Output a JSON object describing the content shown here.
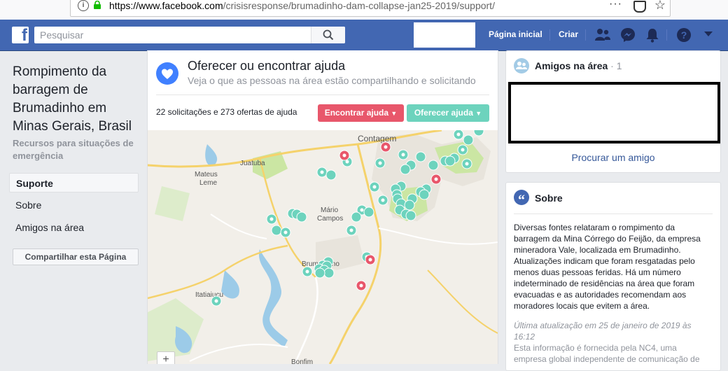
{
  "browser": {
    "url_domain": "https://www.facebook.com",
    "url_path": "/crisisresponse/brumadinho-dam-collapse-jan25-2019/support/",
    "more_icon": "···"
  },
  "header": {
    "search_placeholder": "Pesquisar",
    "home_label": "Página inicial",
    "create_label": "Criar"
  },
  "left": {
    "title": "Rompimento da barragem de Brumadinho em Minas Gerais, Brasil",
    "subtitle": "Recursos para situações de emergência",
    "nav": [
      {
        "label": "Suporte"
      },
      {
        "label": "Sobre"
      },
      {
        "label": "Amigos na área"
      }
    ],
    "share_label": "Compartilhar esta Página"
  },
  "help": {
    "title": "Oferecer ou encontrar ajuda",
    "subtitle": "Veja o que as pessoas na área estão compartilhando e solicitando",
    "counts": "22 solicitações e 273 ofertas de ajuda",
    "find_button": "Encontrar ajuda",
    "offer_button": "Oferecer ajuda"
  },
  "map": {
    "places": [
      "Contagem",
      "Juatuba",
      "Mateus Leme",
      "Mário Campos",
      "Brumadinho",
      "Itatiaiuçu",
      "Bonfim"
    ],
    "zoom_in": "+"
  },
  "friends": {
    "title": "Amigos na área",
    "separator": "·",
    "count": "1",
    "find_link": "Procurar um amigo"
  },
  "about": {
    "title": "Sobre",
    "text": "Diversas fontes relataram o rompimento da barragem da Mina Córrego do Feijão, da empresa mineradora Vale, localizada em Brumadinho. Atualizações indicam que foram resgatadas pelo menos duas pessoas feridas. Há um número indeterminado de residências na área que foram evacuadas e as autoridades recomendam aos moradores locais que evitem a área.",
    "updated": "Última atualização em 25 de janeiro de 2019 às 16:12",
    "source": "Esta informação é fornecida pela NC4, uma empresa global independente de comunicação de"
  },
  "colors": {
    "fb_blue": "#4267b2",
    "request_red": "#e8576b",
    "offer_teal": "#6dd3bd",
    "link_blue": "#365899"
  }
}
